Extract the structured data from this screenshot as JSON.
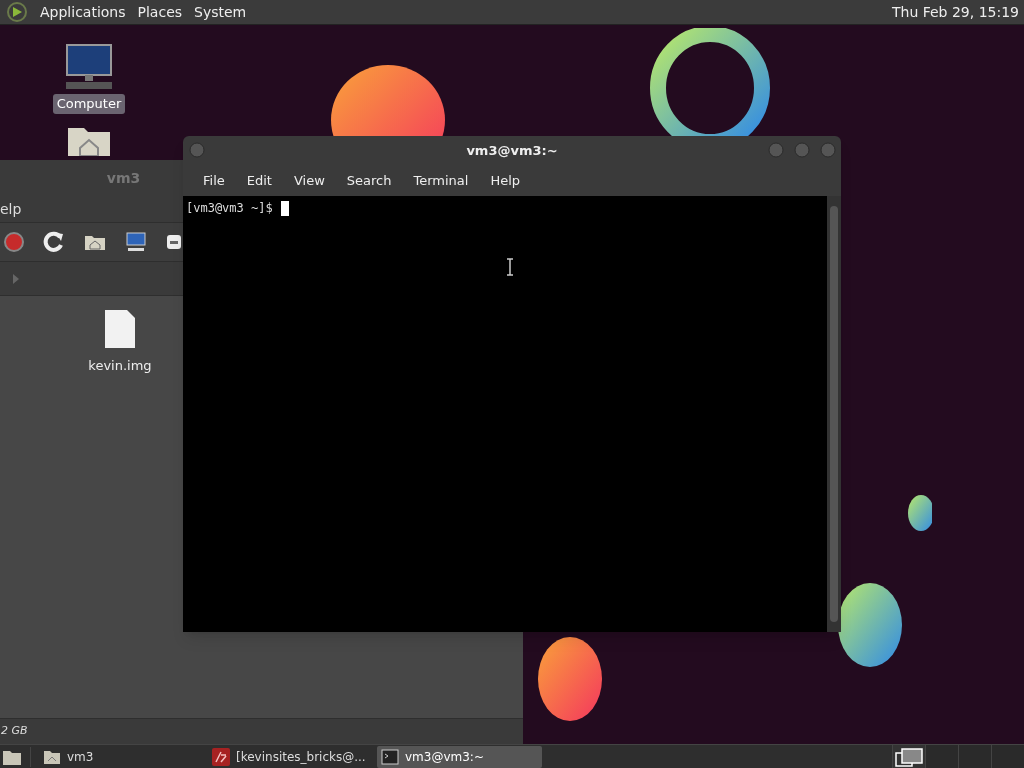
{
  "top_panel": {
    "menus": [
      "Applications",
      "Places",
      "System"
    ],
    "clock": "Thu Feb 29, 15:19"
  },
  "desktop_icons": [
    {
      "kind": "computer",
      "label": "Computer",
      "selected": true
    },
    {
      "kind": "home"
    }
  ],
  "file_manager": {
    "title": "vm3",
    "menus": [
      "elp"
    ],
    "files": [
      {
        "name": "kevin.img"
      }
    ],
    "status": "2 GB"
  },
  "terminal": {
    "title": "vm3@vm3:~",
    "menus": [
      "File",
      "Edit",
      "View",
      "Search",
      "Terminal",
      "Help"
    ],
    "prompt": "[vm3@vm3 ~]$"
  },
  "taskbar": {
    "items": [
      {
        "kind": "folder",
        "label": "vm3",
        "selected": false
      },
      {
        "kind": "ftp",
        "label": "[kevinsites_bricks@...",
        "selected": false
      },
      {
        "kind": "terminal",
        "label": "vm3@vm3:~",
        "selected": true
      }
    ],
    "workspaces": [
      {
        "selected": true
      },
      {
        "selected": false
      },
      {
        "selected": false
      },
      {
        "selected": false
      }
    ]
  }
}
